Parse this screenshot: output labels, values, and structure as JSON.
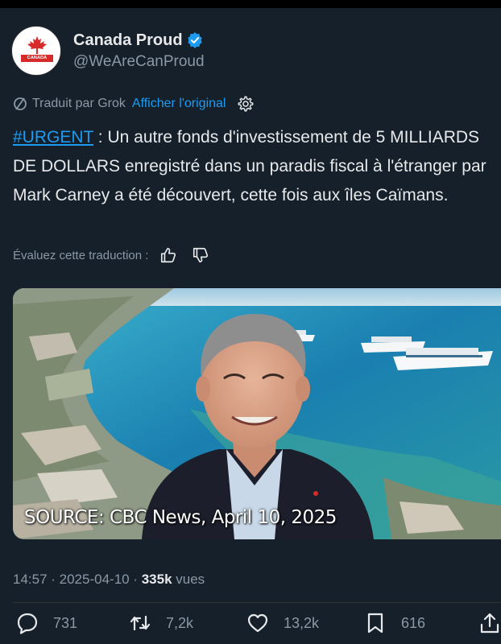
{
  "account": {
    "display_name": "Canada Proud",
    "handle": "@WeAreCanProud",
    "avatar_text": "CANADA PROUD",
    "verified": true
  },
  "translation": {
    "label": "Traduit par Grok",
    "show_original": "Afficher l'original",
    "rate_label": "Évaluez cette traduction :"
  },
  "tweet": {
    "hashtag": "#URGENT",
    "body": " : Un autre fonds d'investissement de 5 MILLIARDS DE DOLLARS enregistré dans un paradis fiscal à l'étranger par Mark Carney a été découvert, cette fois aux îles Caïmans."
  },
  "media": {
    "caption": "SOURCE: CBC News, April 10, 2025"
  },
  "meta": {
    "timestamp": "14:57 · 2025-04-10 · ",
    "views_count": "335k",
    "views_label": " vues"
  },
  "actions": {
    "replies": "731",
    "reposts": "7,2k",
    "likes": "13,2k",
    "bookmarks": "616"
  },
  "colors": {
    "background": "#15202b",
    "accent": "#1d9bf0",
    "secondary_text": "#8b98a5",
    "primary_text": "#e7e9ea"
  }
}
